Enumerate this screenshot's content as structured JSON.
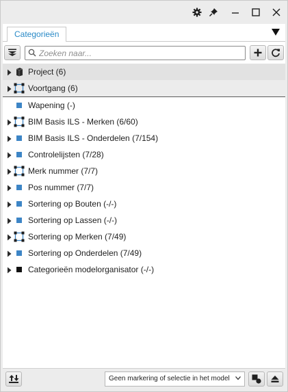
{
  "window": {
    "icons": [
      "gear-icon",
      "pin-icon",
      "minimize-icon",
      "maximize-icon",
      "close-icon"
    ]
  },
  "tabs": [
    {
      "label": "Categorieën",
      "active": true
    }
  ],
  "toolbar": {
    "search_placeholder": "Zoeken naar...",
    "collapse_icon": "collapse-all-icon",
    "add_icon": "plus-icon",
    "refresh_icon": "refresh-icon"
  },
  "tree": {
    "items": [
      {
        "label": "Project (6)",
        "icon": "project-box-icon",
        "expandable": true,
        "style": "header"
      },
      {
        "label": "Voortgang (6)",
        "icon": "category-group-icon",
        "expandable": true,
        "style": "selected"
      },
      {
        "label": "Wapening (-)",
        "icon": "category-square-icon",
        "expandable": false,
        "style": "normal"
      },
      {
        "label": "BIM Basis ILS - Merken (6/60)",
        "icon": "category-group-icon",
        "expandable": true,
        "style": "normal"
      },
      {
        "label": "BIM Basis ILS - Onderdelen (7/154)",
        "icon": "category-square-icon",
        "expandable": true,
        "style": "normal"
      },
      {
        "label": "Controlelijsten (7/28)",
        "icon": "category-square-icon",
        "expandable": true,
        "style": "normal"
      },
      {
        "label": "Merk nummer (7/7)",
        "icon": "category-group-icon",
        "expandable": true,
        "style": "normal"
      },
      {
        "label": "Pos nummer (7/7)",
        "icon": "category-square-icon",
        "expandable": true,
        "style": "normal"
      },
      {
        "label": "Sortering op Bouten (-/-)",
        "icon": "category-square-icon",
        "expandable": true,
        "style": "normal"
      },
      {
        "label": "Sortering op Lassen (-/-)",
        "icon": "category-square-icon",
        "expandable": true,
        "style": "normal"
      },
      {
        "label": "Sortering op Merken (7/49)",
        "icon": "category-group-icon",
        "expandable": true,
        "style": "normal"
      },
      {
        "label": "Sortering op Onderdelen (7/49)",
        "icon": "category-square-icon",
        "expandable": true,
        "style": "normal"
      },
      {
        "label": "Categorieën modelorganisator (-/-)",
        "icon": "organizer-square-icon",
        "expandable": true,
        "style": "normal"
      }
    ]
  },
  "bottombar": {
    "selection_mode": "Geen markering of selectie in het model",
    "left_icon": "import-export-icon",
    "right_icons": [
      "shapes-icon",
      "eject-icon"
    ]
  },
  "colors": {
    "accent_blue": "#2a8ac7",
    "category_blue": "#3d85c6",
    "organizer_black": "#111111"
  }
}
